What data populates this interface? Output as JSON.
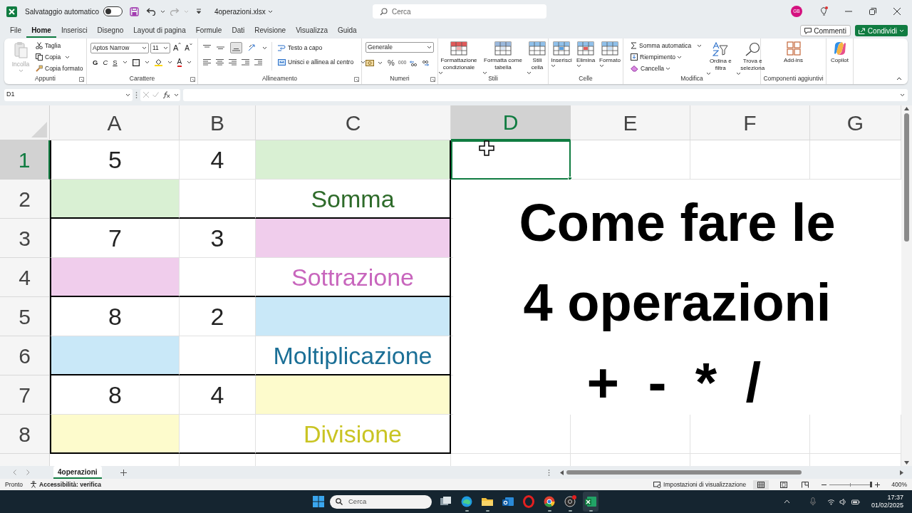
{
  "title_bar": {
    "autosave_label": "Salvataggio automatico",
    "autosave_on": false,
    "file_name": "4operazioni.xlsx",
    "search_placeholder": "Cerca",
    "avatar": "GB"
  },
  "menu_tabs": [
    {
      "label": "File",
      "selected": false
    },
    {
      "label": "Home",
      "selected": true
    },
    {
      "label": "Inserisci",
      "selected": false
    },
    {
      "label": "Disegno",
      "selected": false
    },
    {
      "label": "Layout di pagina",
      "selected": false
    },
    {
      "label": "Formule",
      "selected": false
    },
    {
      "label": "Dati",
      "selected": false
    },
    {
      "label": "Revisione",
      "selected": false
    },
    {
      "label": "Visualizza",
      "selected": false
    },
    {
      "label": "Guida",
      "selected": false
    }
  ],
  "comments_button": "Commenti",
  "share_button": "Condividi",
  "ribbon": {
    "clipboard": {
      "paste": {
        "label": "Incolla",
        "disabled": true
      },
      "cut": "Taglia",
      "copy": "Copia",
      "format_painter": "Copia formato",
      "group_label": "Appunti"
    },
    "font": {
      "family": "Aptos Narrow",
      "size": "11",
      "grow": "A",
      "shrink": "A",
      "bold": "G",
      "italic": "C",
      "underline": "S",
      "font_color": "A",
      "group_label": "Carattere"
    },
    "alignment": {
      "wrap_text": "Testo a capo",
      "merge_center": "Unisci e allinea al centro",
      "group_label": "Allineamento"
    },
    "number": {
      "format": "Generale",
      "percent": "%",
      "thousands": "000",
      "group_label": "Numeri"
    },
    "styles": {
      "buttons": [
        "Formattazione condizionale",
        "Formatta come tabella",
        "Stili cella"
      ],
      "group_label": "Stili"
    },
    "cells": {
      "buttons": [
        "Inserisci",
        "Elimina",
        "Formato"
      ],
      "group_label": "Celle"
    },
    "editing": {
      "autosum": "Somma automatica",
      "fill": "Riempimento",
      "clear": "Cancella",
      "sort_filter": "Ordina e filtra",
      "find_select": "Trova e seleziona",
      "group_label": "Modifica"
    },
    "addins": {
      "button": "Add-ins",
      "group_label": "Componenti aggiuntivi"
    },
    "copilot": {
      "button": "Copilot"
    }
  },
  "name_box": "D1",
  "grid": {
    "columns": [
      {
        "label": "A",
        "selected": false,
        "boxed": true
      },
      {
        "label": "B",
        "selected": false,
        "boxed": true
      },
      {
        "label": "C",
        "selected": false,
        "boxed": true
      },
      {
        "label": "D",
        "selected": true,
        "boxed": false
      },
      {
        "label": "E",
        "selected": false,
        "boxed": false
      },
      {
        "label": "F",
        "selected": false,
        "boxed": false
      },
      {
        "label": "G",
        "selected": false,
        "boxed": false
      }
    ],
    "rows": [
      {
        "label": "1",
        "selected": true,
        "boxed_bottom": false,
        "cells": [
          {
            "kind": "value",
            "text": "5"
          },
          {
            "kind": "value",
            "text": "4"
          },
          {
            "kind": "fill",
            "color": "#d9f0d3"
          },
          {
            "kind": "empty"
          },
          {
            "kind": "empty"
          },
          {
            "kind": "empty"
          },
          {
            "kind": "empty"
          }
        ]
      },
      {
        "label": "2",
        "selected": false,
        "boxed_bottom": true,
        "cells": [
          {
            "kind": "fill",
            "color": "#d9f0d3"
          },
          {
            "kind": "empty"
          },
          {
            "kind": "label",
            "text": "Somma",
            "color": "#2e6b2a"
          },
          {
            "kind": "empty"
          },
          {
            "kind": "empty"
          },
          {
            "kind": "empty"
          },
          {
            "kind": "empty"
          }
        ]
      },
      {
        "label": "3",
        "selected": false,
        "boxed_bottom": false,
        "cells": [
          {
            "kind": "value",
            "text": "7"
          },
          {
            "kind": "value",
            "text": "3"
          },
          {
            "kind": "fill",
            "color": "#f0cdec"
          },
          {
            "kind": "empty"
          },
          {
            "kind": "empty"
          },
          {
            "kind": "empty"
          },
          {
            "kind": "empty"
          }
        ]
      },
      {
        "label": "4",
        "selected": false,
        "boxed_bottom": true,
        "cells": [
          {
            "kind": "fill",
            "color": "#f0cdec"
          },
          {
            "kind": "empty"
          },
          {
            "kind": "label",
            "text": "Sottrazione",
            "color": "#c866bd"
          },
          {
            "kind": "empty"
          },
          {
            "kind": "empty"
          },
          {
            "kind": "empty"
          },
          {
            "kind": "empty"
          }
        ]
      },
      {
        "label": "5",
        "selected": false,
        "boxed_bottom": false,
        "cells": [
          {
            "kind": "value",
            "text": "8"
          },
          {
            "kind": "value",
            "text": "2"
          },
          {
            "kind": "fill",
            "color": "#c9e8f8"
          },
          {
            "kind": "empty"
          },
          {
            "kind": "empty"
          },
          {
            "kind": "empty"
          },
          {
            "kind": "empty"
          }
        ]
      },
      {
        "label": "6",
        "selected": false,
        "boxed_bottom": true,
        "cells": [
          {
            "kind": "fill",
            "color": "#c9e8f8"
          },
          {
            "kind": "empty"
          },
          {
            "kind": "label",
            "text": "Moltiplicazione",
            "color": "#1b6f96"
          },
          {
            "kind": "empty"
          },
          {
            "kind": "empty"
          },
          {
            "kind": "empty"
          },
          {
            "kind": "empty"
          }
        ]
      },
      {
        "label": "7",
        "selected": false,
        "boxed_bottom": false,
        "cells": [
          {
            "kind": "value",
            "text": "8"
          },
          {
            "kind": "value",
            "text": "4"
          },
          {
            "kind": "fill",
            "color": "#fdfbcc"
          },
          {
            "kind": "empty"
          },
          {
            "kind": "empty"
          },
          {
            "kind": "empty"
          },
          {
            "kind": "empty"
          }
        ]
      },
      {
        "label": "8",
        "selected": false,
        "boxed_bottom": true,
        "cells": [
          {
            "kind": "fill",
            "color": "#fdfbcc"
          },
          {
            "kind": "empty"
          },
          {
            "kind": "label",
            "text": "Divisione",
            "color": "#c9c423"
          },
          {
            "kind": "empty"
          },
          {
            "kind": "empty"
          },
          {
            "kind": "empty"
          },
          {
            "kind": "empty"
          }
        ]
      }
    ]
  },
  "overlay_text": [
    "Come fare le",
    "4 operazioni",
    "+ - * /"
  ],
  "sheet_tabs": [
    {
      "label": "4operazioni",
      "selected": true
    }
  ],
  "status_bar": {
    "ready": "Pronto",
    "accessibility": "Accessibilità: verifica",
    "display_settings": "Impostazioni di visualizzazione",
    "zoom_slider": {
      "level": 1
    },
    "zoom": "400%"
  },
  "taskbar": {
    "search_placeholder": "Cerca",
    "time": "17:37",
    "date": "01/02/2025"
  }
}
